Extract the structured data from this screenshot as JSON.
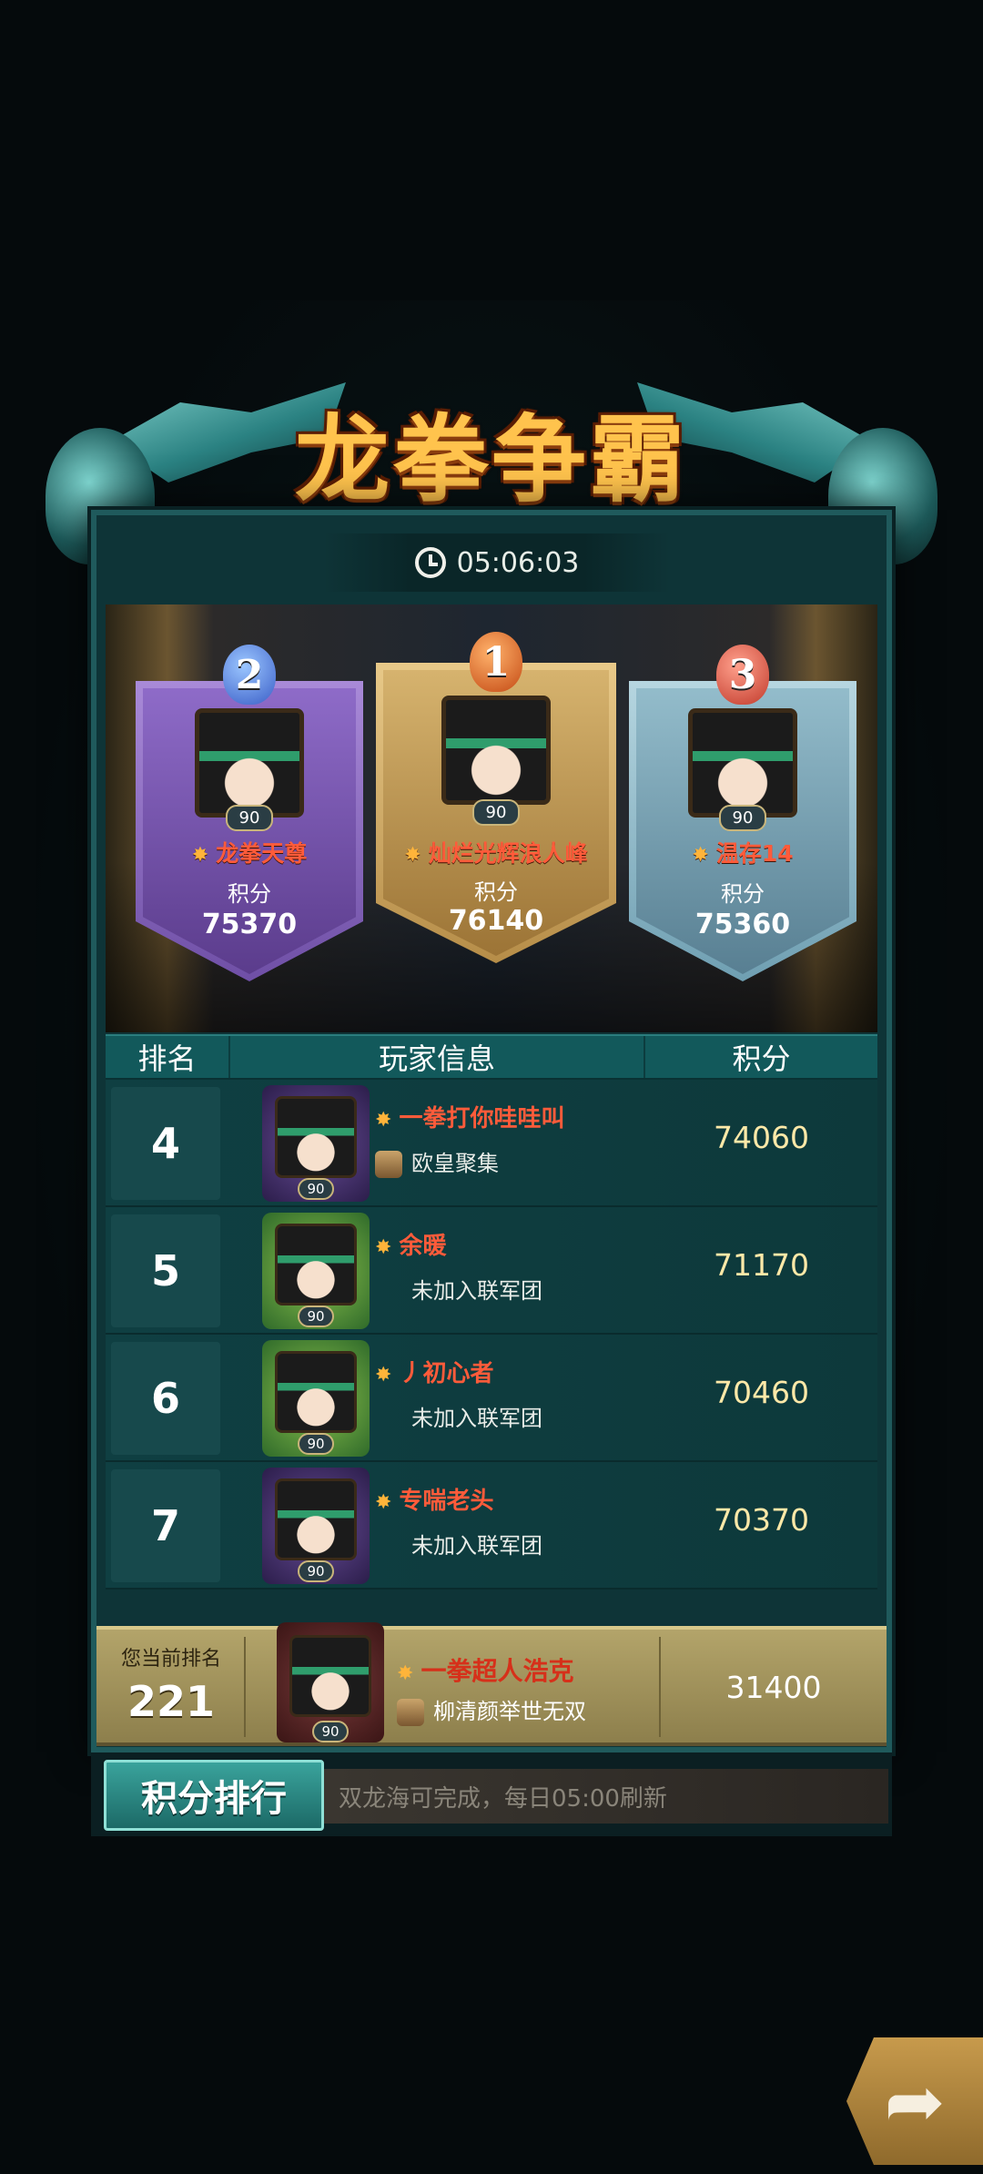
{
  "header": {
    "title": "龙拳争霸",
    "timer": "05:06:03"
  },
  "podium": [
    {
      "place": "2",
      "name": "龙拳天尊",
      "level": "90",
      "score_label": "积分",
      "score": "75370"
    },
    {
      "place": "1",
      "name": "灿烂光辉浪人峰",
      "level": "90",
      "score_label": "积分",
      "score": "76140"
    },
    {
      "place": "3",
      "name": "温存14",
      "level": "90",
      "score_label": "积分",
      "score": "75360"
    }
  ],
  "table": {
    "headers": [
      "排名",
      "玩家信息",
      "积分"
    ],
    "rows": [
      {
        "rank": "4",
        "name": "一拳打你哇哇叫",
        "guild": "欧皇聚集",
        "level": "90",
        "score": "74060"
      },
      {
        "rank": "5",
        "name": "余暖",
        "guild": "未加入联军团",
        "level": "90",
        "score": "71170"
      },
      {
        "rank": "6",
        "name": "丿初心者",
        "guild": "未加入联军团",
        "level": "90",
        "score": "70460"
      },
      {
        "rank": "7",
        "name": "专喘老头",
        "guild": "未加入联军团",
        "level": "90",
        "score": "70370"
      }
    ]
  },
  "my_rank": {
    "label": "您当前排名",
    "rank": "221",
    "name": "一拳超人浩克",
    "guild": "柳清颜举世无双",
    "level": "90",
    "score": "31400"
  },
  "bottom": {
    "tab_label": "积分排行",
    "hint": "双龙海可完成，每日05:00刷新"
  },
  "icons": [
    "clock-icon",
    "star-icon",
    "guild-icon",
    "share-icon"
  ],
  "colors": {
    "accent_gold": "#ffc34d",
    "name_red": "#ff5b3a",
    "panel_teal": "#0e3437"
  }
}
